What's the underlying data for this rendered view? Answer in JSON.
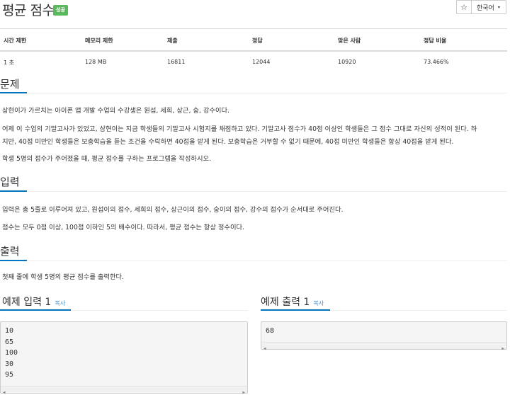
{
  "problem": {
    "title": "평균 점수",
    "badge": "성공"
  },
  "toolbar": {
    "star_icon": "☆",
    "language": "한국어",
    "caret": "▾"
  },
  "stats": {
    "headers": [
      "시간 제한",
      "메모리 제한",
      "제출",
      "정답",
      "맞은 사람",
      "정답 비율"
    ],
    "values": [
      "1 초",
      "128 MB",
      "16811",
      "12044",
      "10920",
      "73.466%"
    ]
  },
  "sections": {
    "problem": {
      "heading": "문제",
      "lines": [
        "상현이가 가르치는 아이폰 앱 개발 수업의 수강생은 원섭, 세희, 상근, 숭, 강수이다.",
        "어제 이 수업의 기말고사가 있었고, 상현이는 지금 학생들의 기말고사 시험지를 채점하고 있다. 기말고사 점수가 40점 이상인 학생들은 그 점수 그대로 자신의 성적이 된다. 하",
        "지만, 40점 미만인 학생들은 보충학습을 듣는 조건을 수락하면 40점을 받게 된다. 보충학습은 거부할 수 없기 때문에, 40점 미만인 학생들은 항상 40점을 받게 된다.",
        "학생 5명의 점수가 주어졌을 때, 평균 점수를 구하는 프로그램을 작성하시오."
      ]
    },
    "input": {
      "heading": "입력",
      "lines": [
        "입력은 총 5줄로 이루어져 있고, 원섭이의 점수, 세희의 점수, 상근이의 점수, 숭이의 점수, 강수의 점수가 순서대로 주어진다.",
        "점수는 모두 0점 이상, 100점 이하인 5의 배수이다. 따라서, 평균 점수는 항상 정수이다."
      ]
    },
    "output": {
      "heading": "출력",
      "lines": [
        "첫째 줄에 학생 5명의 평균 점수를 출력한다."
      ]
    }
  },
  "examples": {
    "input": {
      "title": "예제 입력 1",
      "copy": "복사",
      "lines": [
        "10",
        "65",
        "100",
        "30",
        "95"
      ]
    },
    "output": {
      "title": "예제 출력 1",
      "copy": "복사",
      "lines": [
        "68"
      ]
    }
  },
  "scroll": {
    "left_arrow": "◀",
    "right_arrow": "▶"
  }
}
